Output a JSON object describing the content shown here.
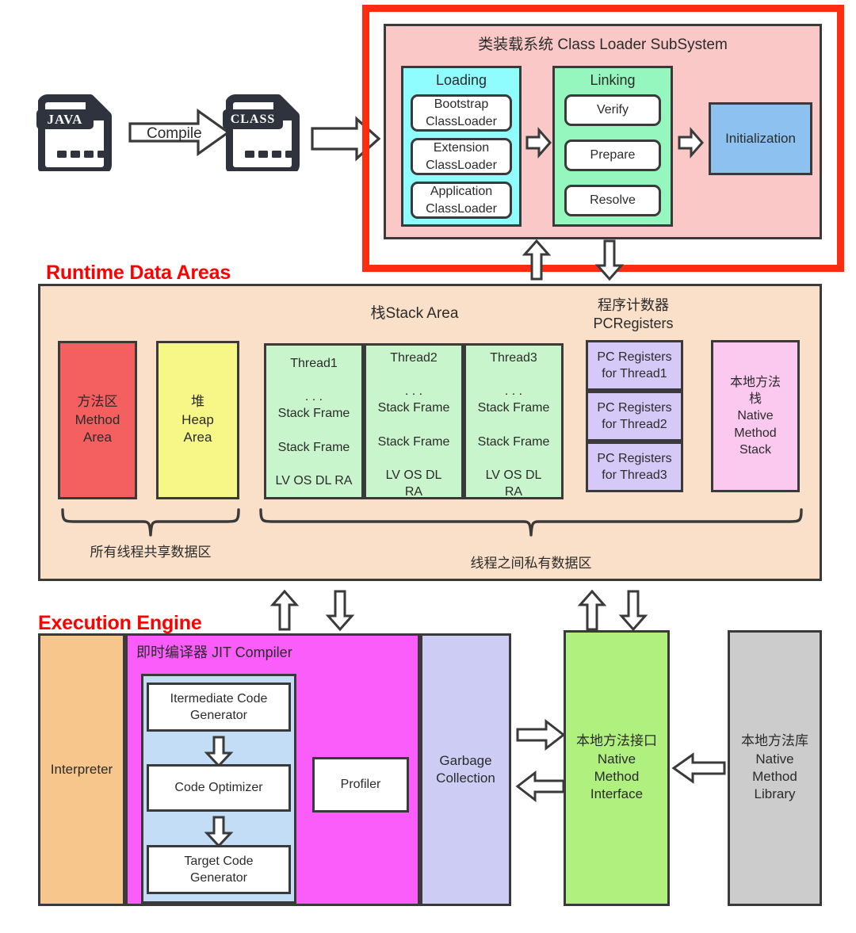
{
  "diagram": {
    "title_class_loader": "类装载系统 Class Loader SubSystem",
    "section_runtime": "Runtime Data Areas",
    "section_execution": "Execution Engine"
  },
  "source_flow": {
    "java_file_badge": "JAVA",
    "class_file_badge": "CLASS",
    "compile_label": "Compile"
  },
  "class_loader": {
    "loading": {
      "title": "Loading",
      "items": [
        "Bootstrap\nClassLoader",
        "Extension\nClassLoader",
        "Application\nClassLoader"
      ]
    },
    "linking": {
      "title": "Linking",
      "items": [
        "Verify",
        "Prepare",
        "Resolve"
      ]
    },
    "initialization": "Initialization"
  },
  "runtime_data_areas": {
    "stack_area_title": "栈Stack Area",
    "pc_registers_title": "程序计数器\nPCRegisters",
    "method_area": "方法区\nMethod\nArea",
    "heap_area": "堆\nHeap\nArea",
    "threads": [
      {
        "name": "Thread1",
        "lines": "Thread1\n\n. . .\nStack Frame\n\nStack Frame\n\nLV OS DL RA"
      },
      {
        "name": "Thread2",
        "lines": "Thread2\n\n. . .\nStack Frame\n\nStack Frame\n\nLV OS DL\nRA"
      },
      {
        "name": "Thread3",
        "lines": "Thread3\n\n. . .\nStack Frame\n\nStack Frame\n\nLV OS DL\nRA"
      }
    ],
    "pc_registers": [
      "PC Registers\nfor Thread1",
      "PC Registers\nfor Thread2",
      "PC Registers\nfor Thread3"
    ],
    "native_method_stack": "本地方法\n栈\nNative\nMethod\nStack",
    "shared_label": "所有线程共享数据区",
    "private_label": "线程之间私有数据区"
  },
  "execution_engine": {
    "interpreter": "Interpreter",
    "jit_title": "即时编译器 JIT Compiler",
    "jit_stages": [
      "Itermediate Code\nGenerator",
      "Code Optimizer",
      "Target Code\nGenerator"
    ],
    "profiler": "Profiler",
    "garbage_collection": "Garbage\nCollection",
    "native_method_interface": "本地方法接口\nNative\nMethod\nInterface",
    "native_method_library": "本地方法库\nNative\nMethod\nLibrary"
  },
  "colors": {
    "red_frame": "#ff2d10",
    "section_title": "#ff0000",
    "class_loader_bg": "#fbc8c8",
    "loading_bg": "#8ffdfd",
    "linking_bg": "#96f7be",
    "initialization_bg": "#8dc2f0",
    "runtime_bg": "#fae0c8",
    "method_area_bg": "#f4605f",
    "heap_bg": "#f7f787",
    "thread_bg": "#c9f5cd",
    "pc_register_bg": "#d5c9f7",
    "native_stack_bg": "#fbc9ef",
    "interpreter_bg": "#f7c68c",
    "jit_bg": "#fb5dfb",
    "jit_inner_bg": "#c2ddf5",
    "gc_bg": "#ccccf5",
    "nmi_bg": "#b0f07f",
    "nml_bg": "#cccccc",
    "stroke": "#3a3a3a"
  }
}
